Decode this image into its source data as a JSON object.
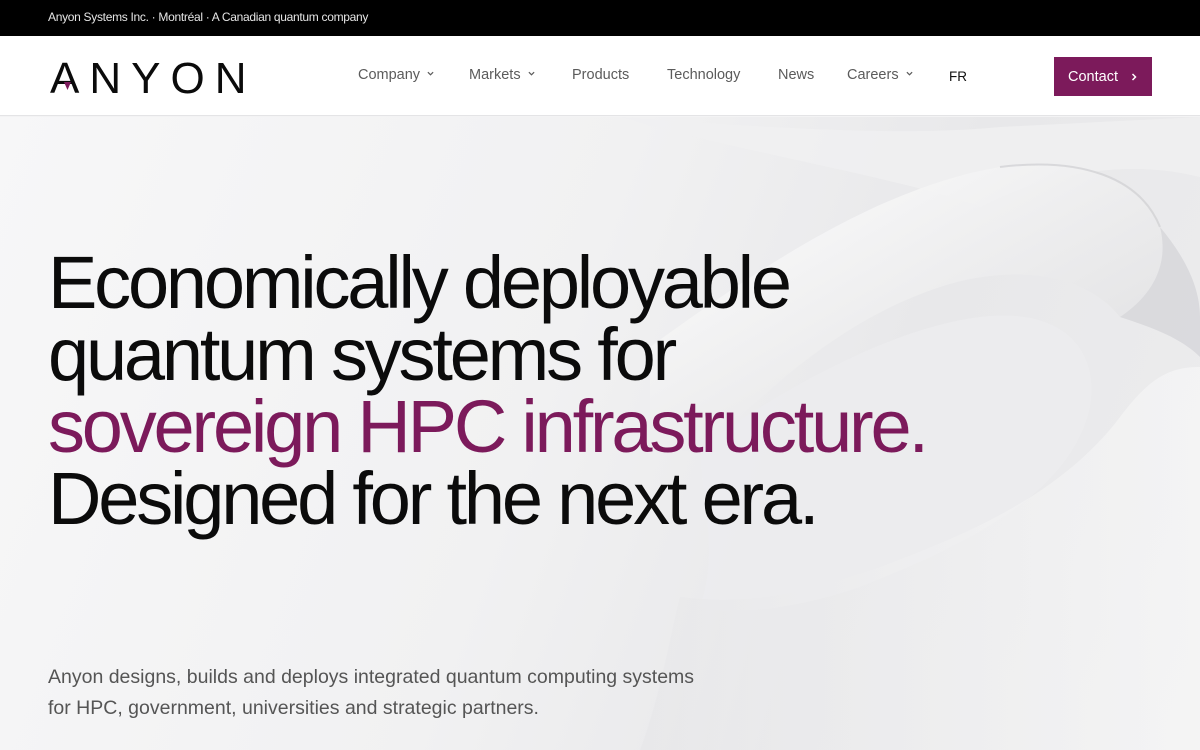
{
  "topbar": {
    "text": "Anyon Systems Inc. · Montréal · A Canadian quantum company"
  },
  "brand": {
    "logo_text": "ANYON",
    "accent_color": "#7c1a5b"
  },
  "nav": {
    "items": [
      {
        "label": "Company",
        "has_dropdown": true
      },
      {
        "label": "Markets",
        "has_dropdown": true
      },
      {
        "label": "Products",
        "has_dropdown": false
      },
      {
        "label": "Technology",
        "has_dropdown": false
      },
      {
        "label": "News",
        "has_dropdown": false
      },
      {
        "label": "Careers",
        "has_dropdown": true
      }
    ],
    "language": "FR",
    "contact_label": "Contact"
  },
  "hero": {
    "headline_part1": "Economically deployable quantum systems for",
    "headline_accent": "sovereign HPC infrastructure.",
    "headline_part2": "Designed for the next era.",
    "subtext": "Anyon designs, builds and deploys integrated quantum computing systems for HPC, government, universities and strategic partners."
  }
}
